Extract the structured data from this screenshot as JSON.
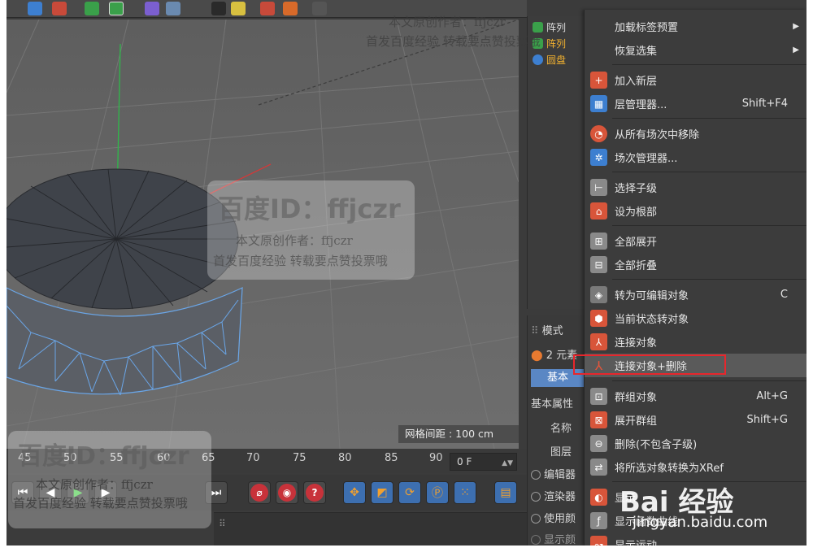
{
  "viewport": {
    "grid_readout": "网格间距 : 100 cm"
  },
  "timeline": {
    "ticks": [
      "45",
      "50",
      "55",
      "60",
      "65",
      "70",
      "75",
      "80",
      "85",
      "90"
    ],
    "frame_value": "0 F"
  },
  "object_manager": {
    "items": [
      "阵列",
      "阵列",
      "圆盘"
    ]
  },
  "attributes": {
    "mode_label": "模式",
    "elements_label": "2 元素",
    "tab_basic": "基本",
    "section_title": "基本属性",
    "name_label": "名称",
    "layer_label": "图层",
    "options": [
      "编辑器",
      "渲染器",
      "使用颜",
      "显示颜"
    ]
  },
  "context_menu": {
    "items": [
      {
        "label": "加载标签预置",
        "shortcut": "",
        "submenu": true,
        "icon": ""
      },
      {
        "label": "恢复选集",
        "shortcut": "",
        "submenu": true,
        "icon": ""
      },
      {
        "label": "加入新层",
        "shortcut": "",
        "submenu": false,
        "icon": "new-layer-icon"
      },
      {
        "label": "层管理器...",
        "shortcut": "Shift+F4",
        "submenu": false,
        "icon": "layer-manager-icon"
      },
      {
        "label": "从所有场次中移除",
        "shortcut": "",
        "submenu": false,
        "icon": "remove-takes-icon"
      },
      {
        "label": "场次管理器...",
        "shortcut": "",
        "submenu": false,
        "icon": "take-manager-icon"
      },
      {
        "label": "选择子级",
        "shortcut": "",
        "submenu": false,
        "icon": "select-children-icon"
      },
      {
        "label": "设为根部",
        "shortcut": "",
        "submenu": false,
        "icon": "set-root-icon"
      },
      {
        "label": "全部展开",
        "shortcut": "",
        "submenu": false,
        "icon": "expand-all-icon"
      },
      {
        "label": "全部折叠",
        "shortcut": "",
        "submenu": false,
        "icon": "collapse-all-icon"
      },
      {
        "label": "转为可编辑对象",
        "shortcut": "C",
        "submenu": false,
        "icon": "make-editable-icon"
      },
      {
        "label": "当前状态转对象",
        "shortcut": "",
        "submenu": false,
        "icon": "current-state-icon"
      },
      {
        "label": "连接对象",
        "shortcut": "",
        "submenu": false,
        "icon": "connect-objects-icon"
      },
      {
        "label": "连接对象+删除",
        "shortcut": "",
        "submenu": false,
        "icon": "connect-delete-icon"
      },
      {
        "label": "群组对象",
        "shortcut": "Alt+G",
        "submenu": false,
        "icon": "group-objects-icon"
      },
      {
        "label": "展开群组",
        "shortcut": "Shift+G",
        "submenu": false,
        "icon": "expand-group-icon"
      },
      {
        "label": "删除(不包含子级)",
        "shortcut": "",
        "submenu": false,
        "icon": "delete-no-children-icon"
      },
      {
        "label": "将所选对象转换为XRef",
        "shortcut": "",
        "submenu": false,
        "icon": "xref-icon"
      },
      {
        "label": "显示",
        "shortcut": "",
        "submenu": false,
        "icon": "display-icon"
      },
      {
        "label": "显示函数曲线",
        "shortcut": "",
        "submenu": false,
        "icon": "fcurve-icon"
      },
      {
        "label": "显示运动",
        "shortcut": "",
        "submenu": false,
        "icon": "motion-icon"
      }
    ]
  },
  "watermark": {
    "id_line": "百度ID：ffjczr",
    "author_line": "本文原创作者：ffjczr",
    "source_line": "首发百度经验 转载要点赞投票哦",
    "logo_text": "Bai 经验",
    "url": "jingyan.baidu.com"
  },
  "colors": {
    "menu_bg": "#3c3c3c",
    "highlight_border": "#e8262c",
    "accent_blue": "#5a87c4",
    "wire_blue": "#6aa6e8"
  }
}
